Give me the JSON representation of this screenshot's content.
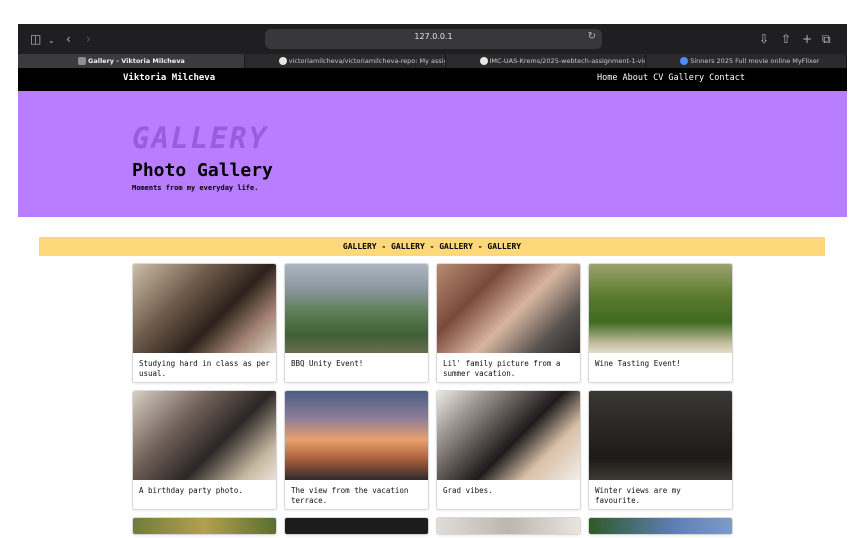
{
  "browser": {
    "address": "127.0.0.1",
    "tabs": [
      {
        "title": "Gallery - Viktoria Milcheva",
        "active": true
      },
      {
        "title": "victoriamilcheva/victoriamilcheva-repo: My assignment r...",
        "active": false
      },
      {
        "title": "IMC-UAS-Krems/2025-webtech-assignment-1-victoriam...",
        "active": false
      },
      {
        "title": "Sinners 2025 Full movie online MyFlixer",
        "active": false
      }
    ]
  },
  "site": {
    "brand": "Viktoria Milcheva",
    "nav": [
      "Home",
      "About",
      "CV",
      "Gallery",
      "Contact"
    ]
  },
  "hero": {
    "kicker": "GALLERY",
    "title": "Photo Gallery",
    "subtitle": "Moments from my everyday life."
  },
  "marquee": "GALLERY - GALLERY - GALLERY - GALLERY",
  "gallery": [
    {
      "caption": "Studying hard in class as per usual."
    },
    {
      "caption": "BBQ Unity Event!"
    },
    {
      "caption": "Lil' family picture from a summer vacation."
    },
    {
      "caption": "Wine Tasting Event!"
    },
    {
      "caption": "A birthday party photo."
    },
    {
      "caption": "The view from the vacation terrace."
    },
    {
      "caption": "Grad vibes."
    },
    {
      "caption": "Winter views are my favourite."
    }
  ],
  "colors": {
    "hero_bg": "#b97dff",
    "hero_kicker": "#9a5bdc",
    "marquee_bg": "#fdd87a",
    "nav_bg": "#000000"
  }
}
